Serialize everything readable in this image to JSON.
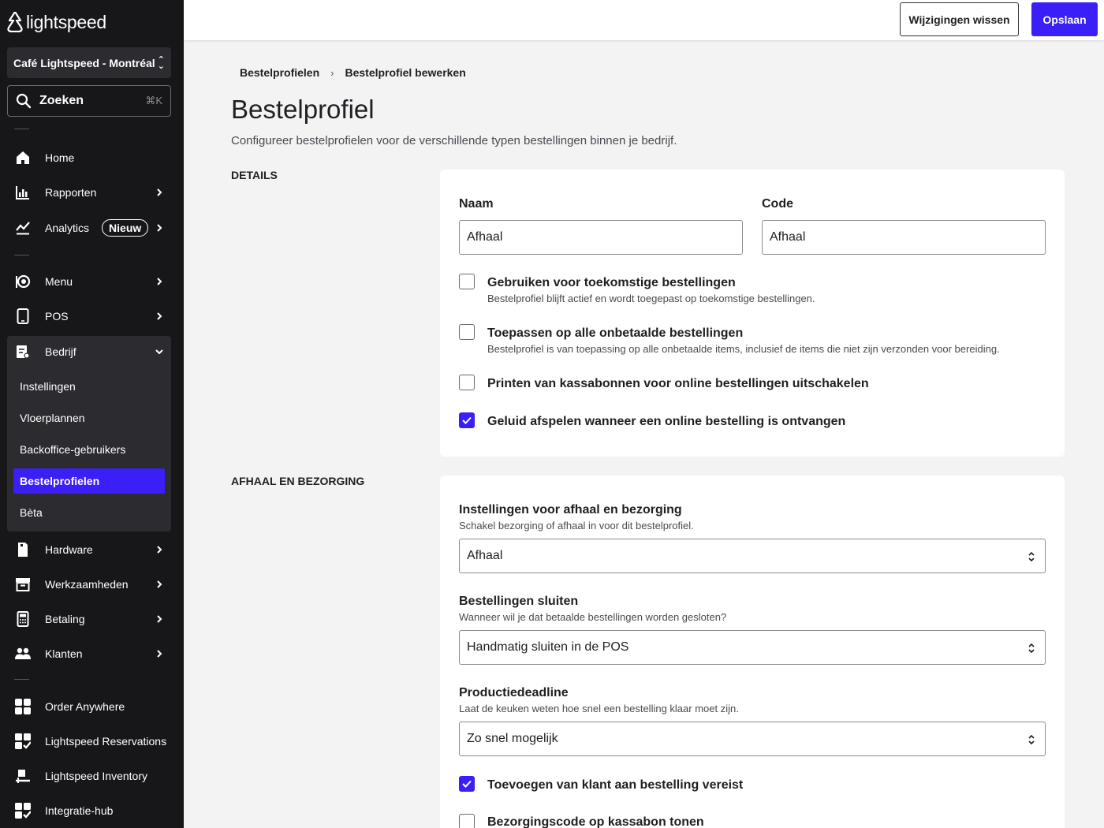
{
  "brand": {
    "logo_text": "lightspeed",
    "accent": "#3a1ff7"
  },
  "sidebar": {
    "location": "Café Lightspeed - Montréal",
    "search": {
      "label": "Zoeken",
      "shortcut": "⌘K"
    },
    "items": [
      {
        "label": "Home",
        "icon": "home-icon"
      },
      {
        "label": "Rapporten",
        "icon": "bar-chart-icon"
      },
      {
        "label": "Analytics",
        "icon": "trend-line-icon",
        "badge": "Nieuw"
      },
      {
        "label": "Menu",
        "icon": "menu-plate-icon"
      },
      {
        "label": "POS",
        "icon": "tablet-icon"
      },
      {
        "label": "Bedrijf",
        "icon": "business-icon",
        "expanded": true
      },
      {
        "label": "Hardware",
        "icon": "hardware-icon"
      },
      {
        "label": "Werkzaamheden",
        "icon": "archive-box-icon"
      },
      {
        "label": "Betaling",
        "icon": "payment-terminal-icon"
      },
      {
        "label": "Klanten",
        "icon": "users-icon"
      },
      {
        "label": "Order Anywhere",
        "icon": "order-anywhere-icon"
      },
      {
        "label": "Lightspeed Reservations",
        "icon": "reservations-icon"
      },
      {
        "label": "Lightspeed Inventory",
        "icon": "inventory-icon"
      },
      {
        "label": "Integratie-hub",
        "icon": "integration-hub-icon"
      }
    ],
    "sub_items": [
      {
        "label": "Instellingen"
      },
      {
        "label": "Vloerplannen"
      },
      {
        "label": "Backoffice-gebruikers"
      },
      {
        "label": "Bestelprofielen",
        "active": true
      },
      {
        "label": "Bèta"
      }
    ]
  },
  "toolbar": {
    "discard_label": "Wijzigingen wissen",
    "save_label": "Opslaan"
  },
  "breadcrumb": {
    "parent": "Bestelprofielen",
    "current": "Bestelprofiel bewerken"
  },
  "page": {
    "title": "Bestelprofiel",
    "description": "Configureer bestelprofielen voor de verschillende typen bestellingen binnen je bedrijf."
  },
  "details": {
    "section_label": "DETAILS",
    "name_label": "Naam",
    "name_value": "Afhaal",
    "code_label": "Code",
    "code_value": "Afhaal",
    "checkboxes": [
      {
        "label": "Gebruiken voor toekomstige bestellingen",
        "help": "Bestelprofiel blijft actief en wordt toegepast op toekomstige bestellingen.",
        "checked": false
      },
      {
        "label": "Toepassen op alle onbetaalde bestellingen",
        "help": "Bestelprofiel is van toepassing op alle onbetaalde items, inclusief de items die niet zijn verzonden voor bereiding.",
        "checked": false
      },
      {
        "label": "Printen van kassabonnen voor online bestellingen uitschakelen",
        "checked": false
      },
      {
        "label": "Geluid afspelen wanneer een online bestelling is ontvangen",
        "checked": true
      }
    ]
  },
  "pickup": {
    "section_label": "AFHAAL EN BEZORGING",
    "fields": [
      {
        "label": "Instellingen voor afhaal en bezorging",
        "help": "Schakel bezorging of afhaal in voor dit bestelprofiel.",
        "value": "Afhaal"
      },
      {
        "label": "Bestellingen sluiten",
        "help": "Wanneer wil je dat betaalde bestellingen worden gesloten?",
        "value": "Handmatig sluiten in de POS"
      },
      {
        "label": "Productiedeadline",
        "help": "Laat de keuken weten hoe snel een bestelling klaar moet zijn.",
        "value": "Zo snel mogelijk"
      }
    ],
    "checkboxes": [
      {
        "label": "Toevoegen van klant aan bestelling vereist",
        "checked": true
      },
      {
        "label": "Bezorgingscode op kassabon tonen",
        "checked": false
      }
    ]
  }
}
